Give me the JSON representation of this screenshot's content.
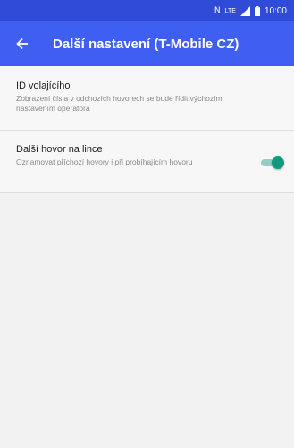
{
  "status_bar": {
    "icons": [
      "nfc-icon",
      "lte-icon",
      "signal-icon",
      "battery-icon"
    ],
    "nfc_glyph": "N",
    "lte_label": "LTE",
    "time": "10:00"
  },
  "app_bar": {
    "back_icon": "arrow-left-icon",
    "title": "Další nastavení (T-Mobile CZ)"
  },
  "settings": [
    {
      "title": "ID volajícího",
      "summary": "Zobrazení čísla v odchozích hovorech se bude řídit výchozím nastavením operátora"
    },
    {
      "title": "Další hovor na lince",
      "summary": "Oznamovat příchozí hovory i při probíhajícím hovoru",
      "toggle_on": true
    }
  ],
  "colors": {
    "status_bar": "#2f4bd8",
    "app_bar": "#3f5ef2",
    "toggle_accent": "#0f9a7d",
    "background": "#f2f2f2"
  }
}
